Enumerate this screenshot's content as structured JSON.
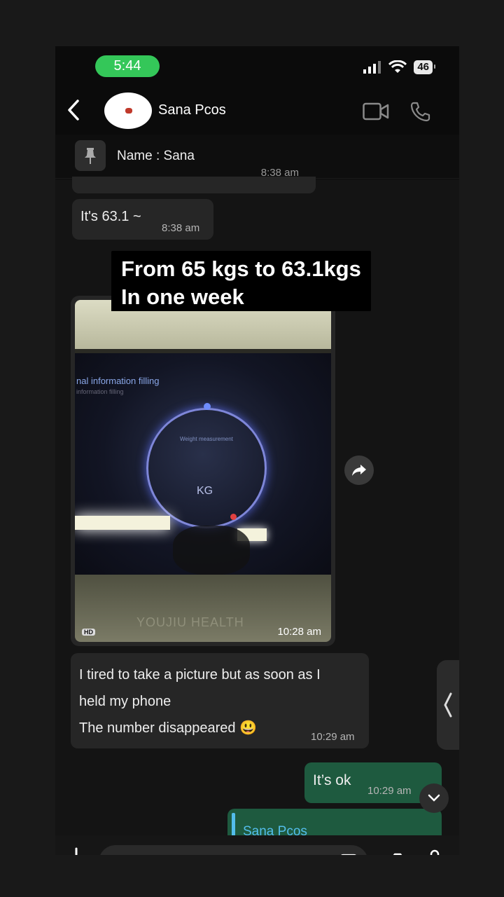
{
  "status_bar": {
    "time": "5:44",
    "battery": "46"
  },
  "header": {
    "contact_name": "Sana Pcos"
  },
  "pinned": {
    "text": "Name : Sana"
  },
  "messages": [
    {
      "type": "incoming_cut",
      "time": "8:38 am"
    },
    {
      "type": "incoming",
      "text": "It's 63.1 ~",
      "time": "8:38 am"
    },
    {
      "type": "image",
      "caption_line1": "From 65 kgs to 63.1kgs",
      "caption_line2": "In one week",
      "time": "10:28 am",
      "hd_badge": "HD",
      "photo_text": {
        "screen_title": "nal information filling",
        "screen_subtitle": "information filling",
        "gauge_label": "Weight measurement",
        "unit": "KG",
        "brand": "YOUJIU HEALTH"
      }
    },
    {
      "type": "incoming",
      "lines": [
        "I tired to take a picture but as soon as I",
        "held my phone",
        "The number disappeared 😃"
      ],
      "time": "10:29 am"
    },
    {
      "type": "outgoing",
      "text": "It’s ok",
      "time": "10:29 am"
    },
    {
      "type": "outgoing_reply_preview",
      "quoted_name": "Sana Pcos"
    }
  ],
  "icons": [
    "back-chevron",
    "avatar",
    "video-camera",
    "phone",
    "pin",
    "forward-share",
    "scroll-down-chevron",
    "side-panel-chevron",
    "plus",
    "sticker",
    "camera",
    "microphone"
  ],
  "colors": {
    "status_green": "#34c759",
    "outgoing_bubble": "#1e5a3f",
    "incoming_bubble": "#262626",
    "link_blue": "#53bdeb"
  }
}
